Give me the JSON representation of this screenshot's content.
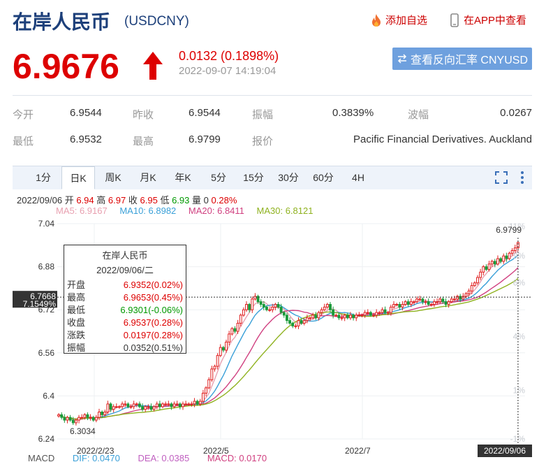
{
  "header": {
    "title": "在岸人民币",
    "code": "(USDCNY)",
    "add_fav": "添加自选",
    "view_app": "在APP中查看"
  },
  "quote": {
    "price": "6.9676",
    "change": "0.0132 (0.1898%)",
    "time": "2022-09-07 14:19:04",
    "switch_label": "查看反向汇率 CNYUSD",
    "direction": "up"
  },
  "stats": {
    "row1": [
      {
        "label": "今开",
        "value": "6.9544"
      },
      {
        "label": "昨收",
        "value": "6.9544"
      },
      {
        "label": "振幅",
        "value": "0.3839%"
      },
      {
        "label": "波幅",
        "value": "0.0267"
      }
    ],
    "row2": [
      {
        "label": "最低",
        "value": "6.9532"
      },
      {
        "label": "最高",
        "value": "6.9799"
      },
      {
        "label": "报价",
        "value": "Pacific Financial Derivatives. Auckland"
      }
    ]
  },
  "tabs": [
    "1分",
    "日K",
    "周K",
    "月K",
    "年K",
    "5分",
    "15分",
    "30分",
    "60分",
    "4H"
  ],
  "active_tab": "日K",
  "ohlc": {
    "date": "2022/09/06",
    "open_label": "开",
    "open": "6.94",
    "high_label": "高",
    "high": "6.97",
    "close_label": "收",
    "close": "6.95",
    "low_label": "低",
    "low": "6.93",
    "vol_label": "量",
    "vol": "0",
    "pct": "0.28%"
  },
  "ma": [
    {
      "label": "MA5: 6.9167",
      "color": "#e8a0b0"
    },
    {
      "label": "MA10: 6.8982",
      "color": "#3aa0d8"
    },
    {
      "label": "MA20: 6.8411",
      "color": "#d04080"
    },
    {
      "label": "MA30: 6.8121",
      "color": "#8fb21f"
    }
  ],
  "tooltip": {
    "title": "在岸人民币",
    "date": "2022/09/06/二",
    "rows": [
      {
        "label": "开盘",
        "value": "6.9352(0.02%)",
        "color": "#d00"
      },
      {
        "label": "最高",
        "value": "6.9653(0.45%)",
        "color": "#d00"
      },
      {
        "label": "最低",
        "value": "6.9301(-0.06%)",
        "color": "#090"
      },
      {
        "label": "收盘",
        "value": "6.9537(0.28%)",
        "color": "#d00"
      },
      {
        "label": "涨跌",
        "value": "0.0197(0.28%)",
        "color": "#d00"
      },
      {
        "label": "振幅",
        "value": "0.0352(0.51%)",
        "color": "#333"
      }
    ]
  },
  "macd": {
    "label": "MACD",
    "dif": "DIF: 0.0470",
    "dea": "DEA: 0.0385",
    "macd": "MACD: 0.0170"
  },
  "chart_data": {
    "type": "candlestick",
    "y_ticks_left": [
      "7.04",
      "6.88",
      "6.72",
      "6.56",
      "6.4",
      "6.24"
    ],
    "y_ticks_right": [
      "11%",
      "9%",
      "6%",
      "4%",
      "1%",
      "-1%"
    ],
    "x_ticks": [
      "2022/2/23",
      "2022/5",
      "2022/7"
    ],
    "x_cursor_label": "2022/09/06",
    "crosshair_price": "6.7668",
    "crosshair_pct": "7.1549%",
    "max_label": "6.9799",
    "min_label": "6.3034",
    "ylim": [
      6.24,
      7.04
    ],
    "closes": [
      6.33,
      6.32,
      6.31,
      6.32,
      6.31,
      6.3,
      6.31,
      6.32,
      6.32,
      6.33,
      6.32,
      6.32,
      6.31,
      6.32,
      6.34,
      6.33,
      6.34,
      6.37,
      6.35,
      6.36,
      6.36,
      6.36,
      6.37,
      6.37,
      6.36,
      6.36,
      6.37,
      6.37,
      6.36,
      6.35,
      6.36,
      6.36,
      6.35,
      6.36,
      6.37,
      6.36,
      6.37,
      6.37,
      6.37,
      6.36,
      6.37,
      6.37,
      6.36,
      6.37,
      6.37,
      6.37,
      6.37,
      6.38,
      6.37,
      6.38,
      6.41,
      6.43,
      6.46,
      6.5,
      6.51,
      6.55,
      6.58,
      6.57,
      6.6,
      6.63,
      6.65,
      6.64,
      6.67,
      6.7,
      6.72,
      6.74,
      6.72,
      6.76,
      6.77,
      6.75,
      6.74,
      6.73,
      6.72,
      6.72,
      6.73,
      6.74,
      6.73,
      6.71,
      6.7,
      6.68,
      6.67,
      6.66,
      6.66,
      6.68,
      6.67,
      6.68,
      6.69,
      6.69,
      6.7,
      6.69,
      6.71,
      6.72,
      6.73,
      6.74,
      6.72,
      6.7,
      6.7,
      6.69,
      6.69,
      6.7,
      6.69,
      6.7,
      6.69,
      6.7,
      6.7,
      6.7,
      6.71,
      6.71,
      6.7,
      6.7,
      6.71,
      6.71,
      6.72,
      6.71,
      6.71,
      6.73,
      6.74,
      6.74,
      6.73,
      6.74,
      6.75,
      6.74,
      6.75,
      6.75,
      6.76,
      6.76,
      6.75,
      6.75,
      6.74,
      6.74,
      6.75,
      6.75,
      6.76,
      6.75,
      6.74,
      6.75,
      6.76,
      6.76,
      6.77,
      6.76,
      6.77,
      6.78,
      6.79,
      6.81,
      6.82,
      6.84,
      6.86,
      6.88,
      6.87,
      6.89,
      6.9,
      6.89,
      6.91,
      6.9,
      6.92,
      6.91,
      6.93,
      6.94,
      6.95,
      6.97
    ]
  }
}
